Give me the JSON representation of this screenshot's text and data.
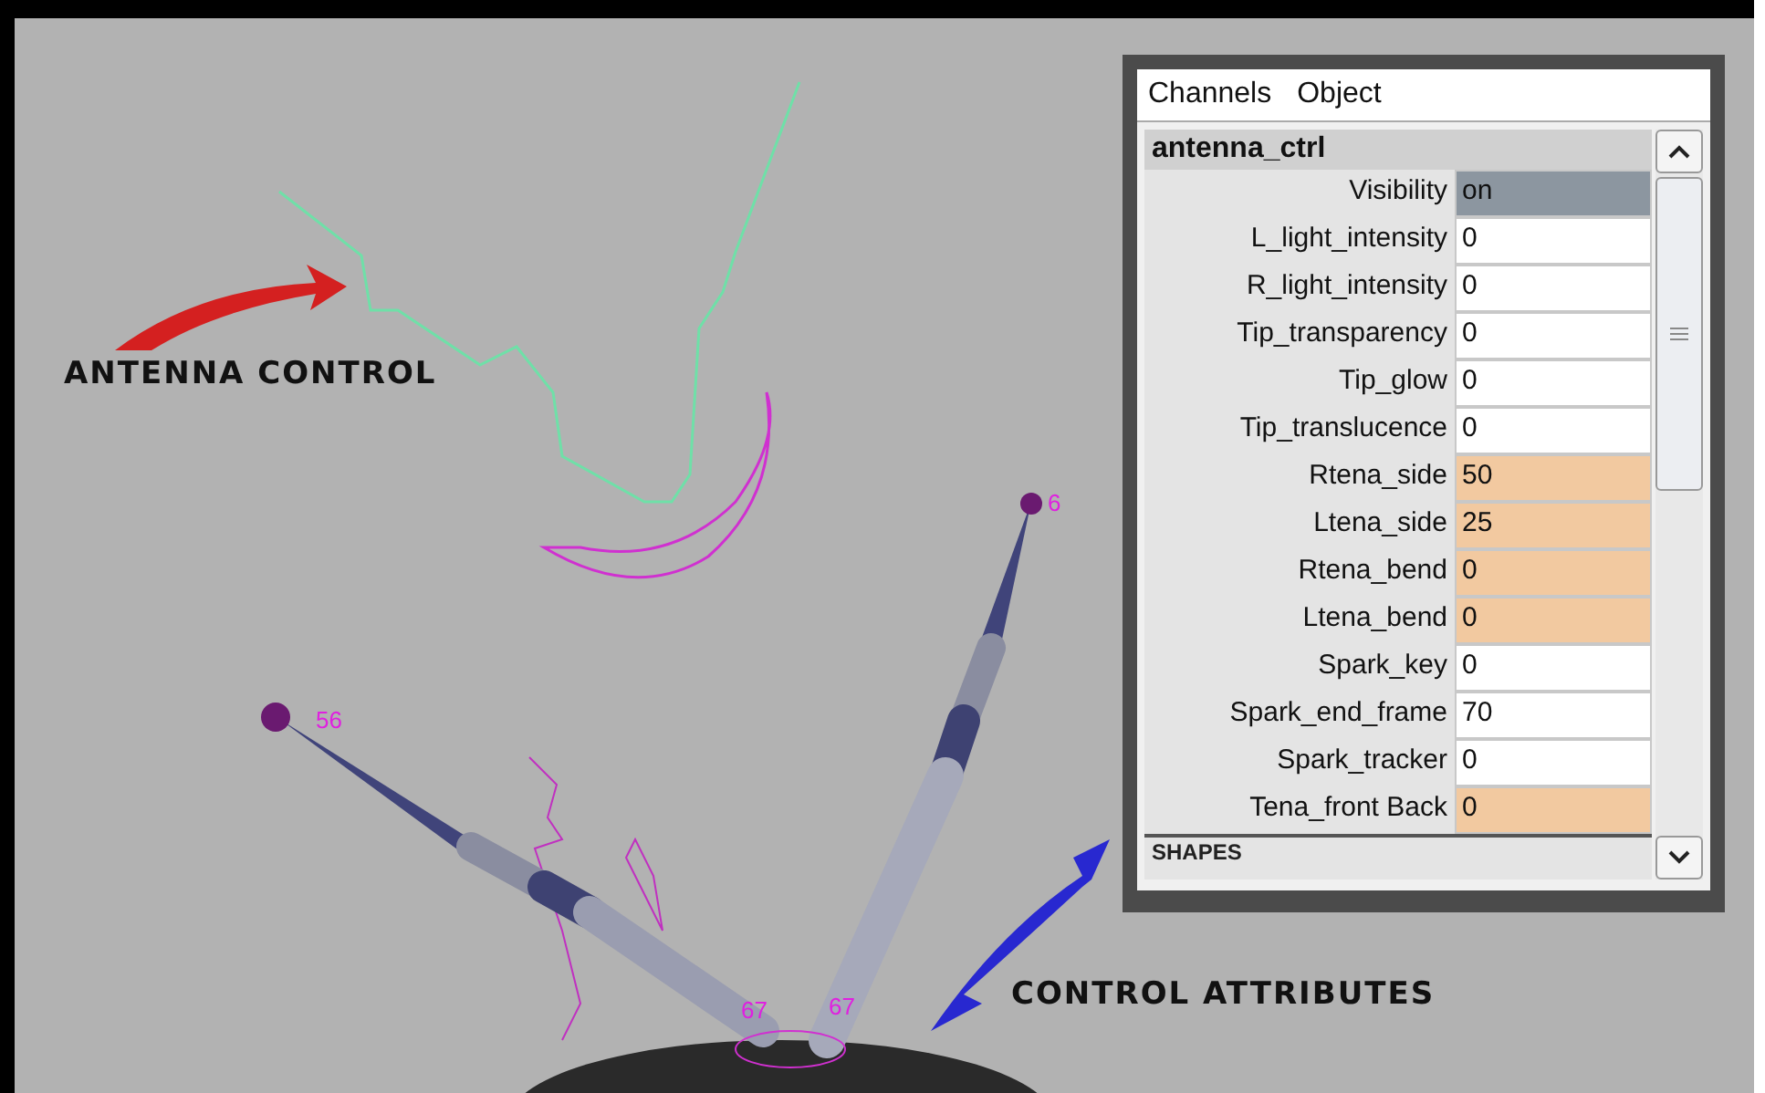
{
  "viewport": {
    "annotations": [
      "ANTENNA CONTROL",
      "CONTROL ATTRIBUTES"
    ],
    "joint_labels": [
      "56",
      "6",
      "67",
      "67"
    ]
  },
  "channel_box": {
    "menu": [
      "Channels",
      "Object"
    ],
    "node": "antenna_ctrl",
    "attributes": [
      {
        "name": "Visibility",
        "value": "on",
        "kind": "toggle"
      },
      {
        "name": "L_light_intensity",
        "value": "0",
        "kind": "plain"
      },
      {
        "name": "R_light_intensity",
        "value": "0",
        "kind": "plain"
      },
      {
        "name": "Tip_transparency",
        "value": "0",
        "kind": "plain"
      },
      {
        "name": "Tip_glow",
        "value": "0",
        "kind": "plain"
      },
      {
        "name": "Tip_translucence",
        "value": "0",
        "kind": "plain"
      },
      {
        "name": "Rtena_side",
        "value": "50",
        "kind": "keyed"
      },
      {
        "name": "Ltena_side",
        "value": "25",
        "kind": "keyed"
      },
      {
        "name": "Rtena_bend",
        "value": "0",
        "kind": "keyed"
      },
      {
        "name": "Ltena_bend",
        "value": "0",
        "kind": "keyed"
      },
      {
        "name": "Spark_key",
        "value": "0",
        "kind": "plain"
      },
      {
        "name": "Spark_end_frame",
        "value": "70",
        "kind": "plain"
      },
      {
        "name": "Spark_tracker",
        "value": "0",
        "kind": "plain"
      },
      {
        "name": "Tena_front Back",
        "value": "0",
        "kind": "keyed"
      }
    ],
    "section": "SHAPES"
  }
}
